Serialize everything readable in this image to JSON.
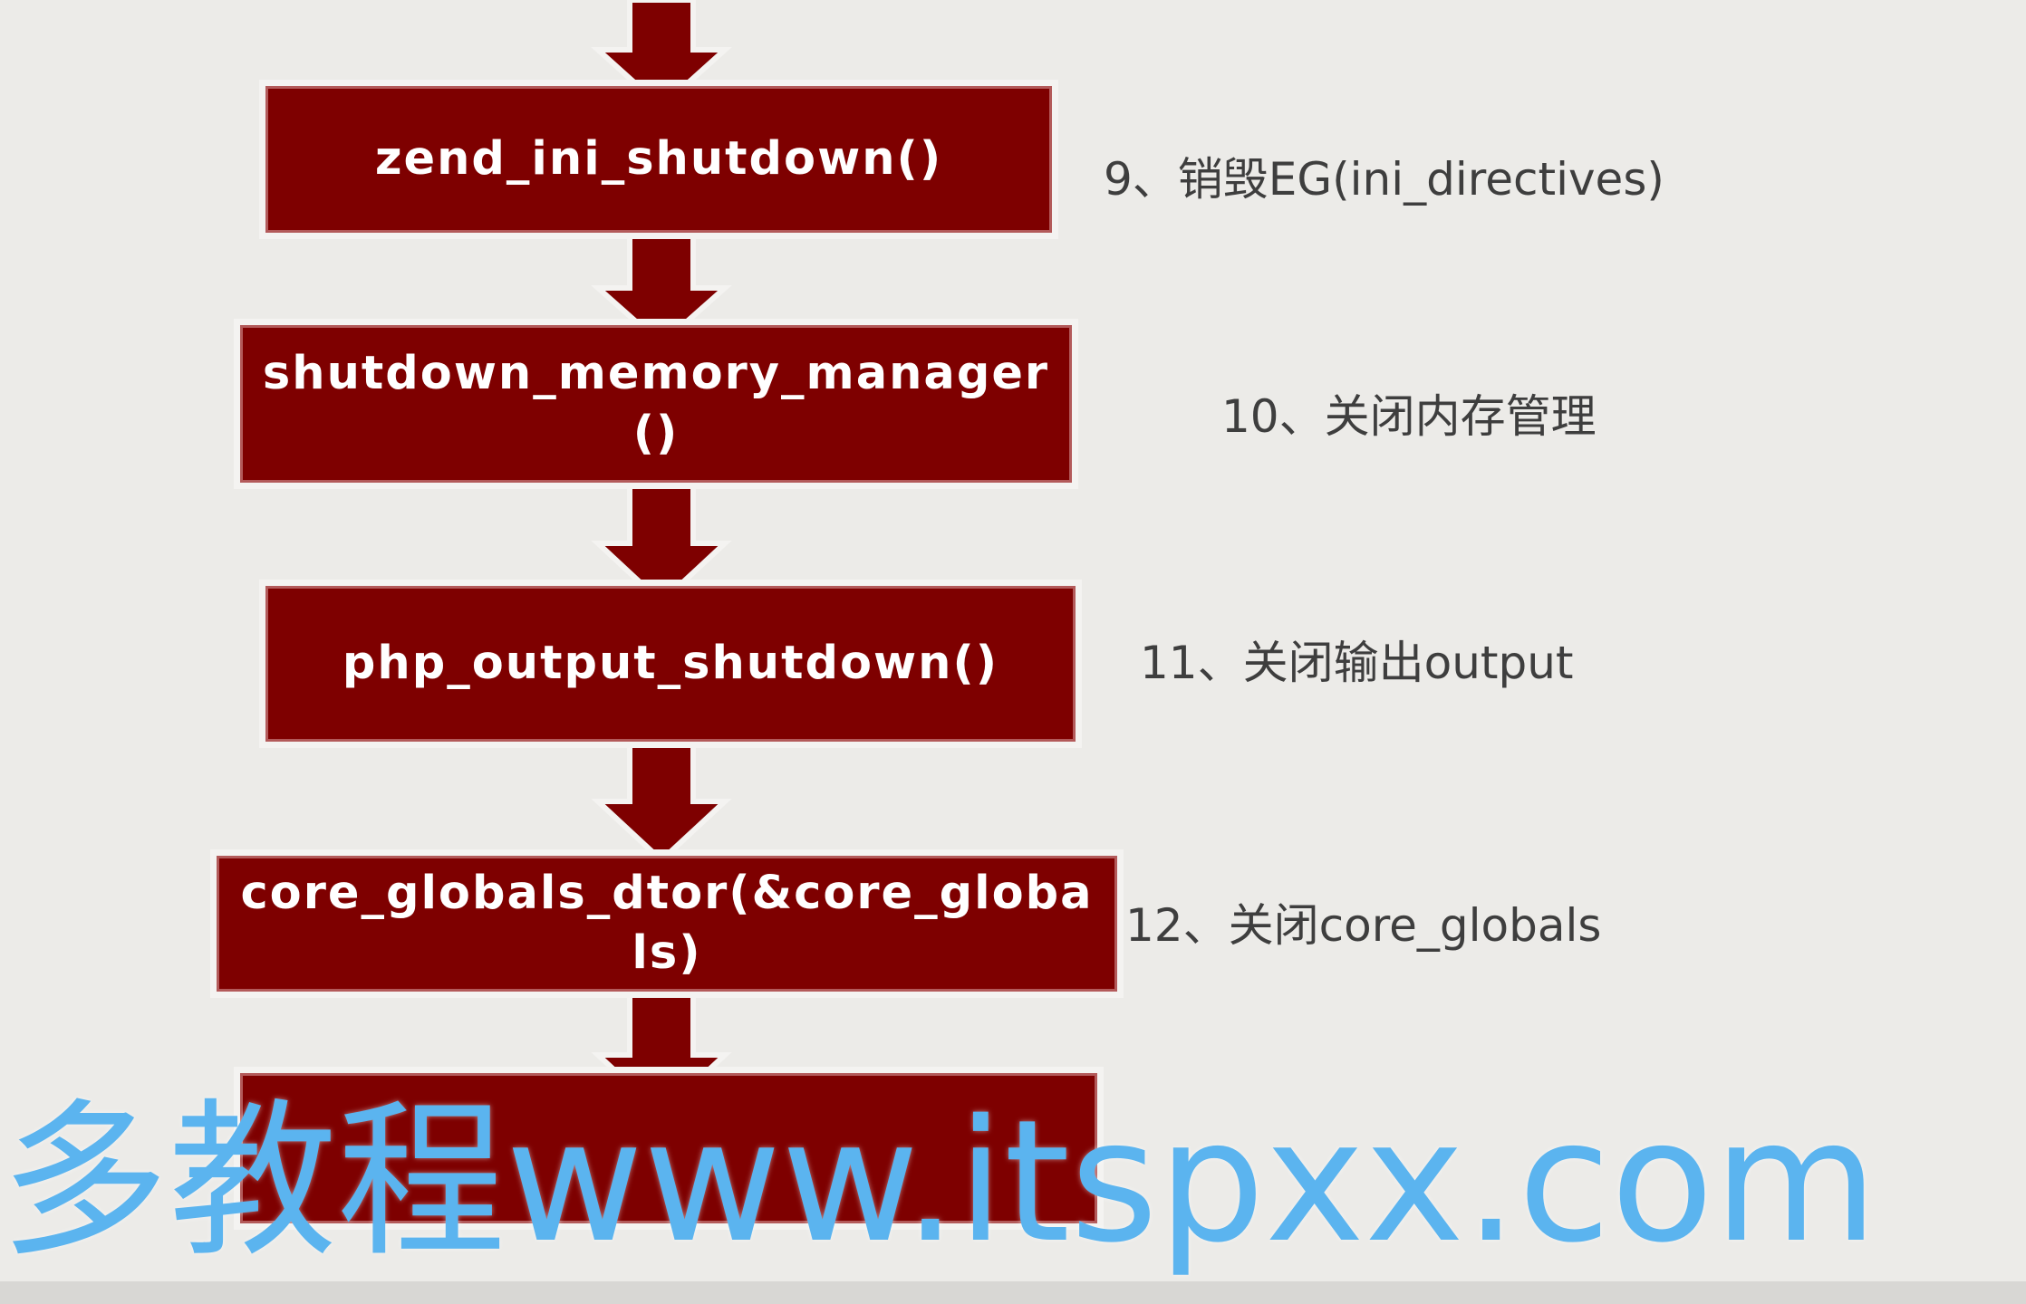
{
  "diagram": {
    "steps": [
      {
        "call": "zend_ini_shutdown()",
        "note": "9、销毁EG(ini_directives)"
      },
      {
        "call": "shutdown_memory_manager()",
        "note": "10、关闭内存管理"
      },
      {
        "call": "php_output_shutdown()",
        "note": "11、关闭输出output"
      },
      {
        "call": "core_globals_dtor(&core_globals)",
        "note": "12、关闭core_globals"
      },
      {
        "call": "",
        "note": ""
      }
    ],
    "colors": {
      "box": "#7e0000",
      "arrow": "#7e0000",
      "note_text": "#3e3e3e",
      "background": "#ecebe8"
    }
  },
  "overlay": {
    "watermark": "多教程www.itspxx.com",
    "watermark_color": "#5bb4ef"
  }
}
